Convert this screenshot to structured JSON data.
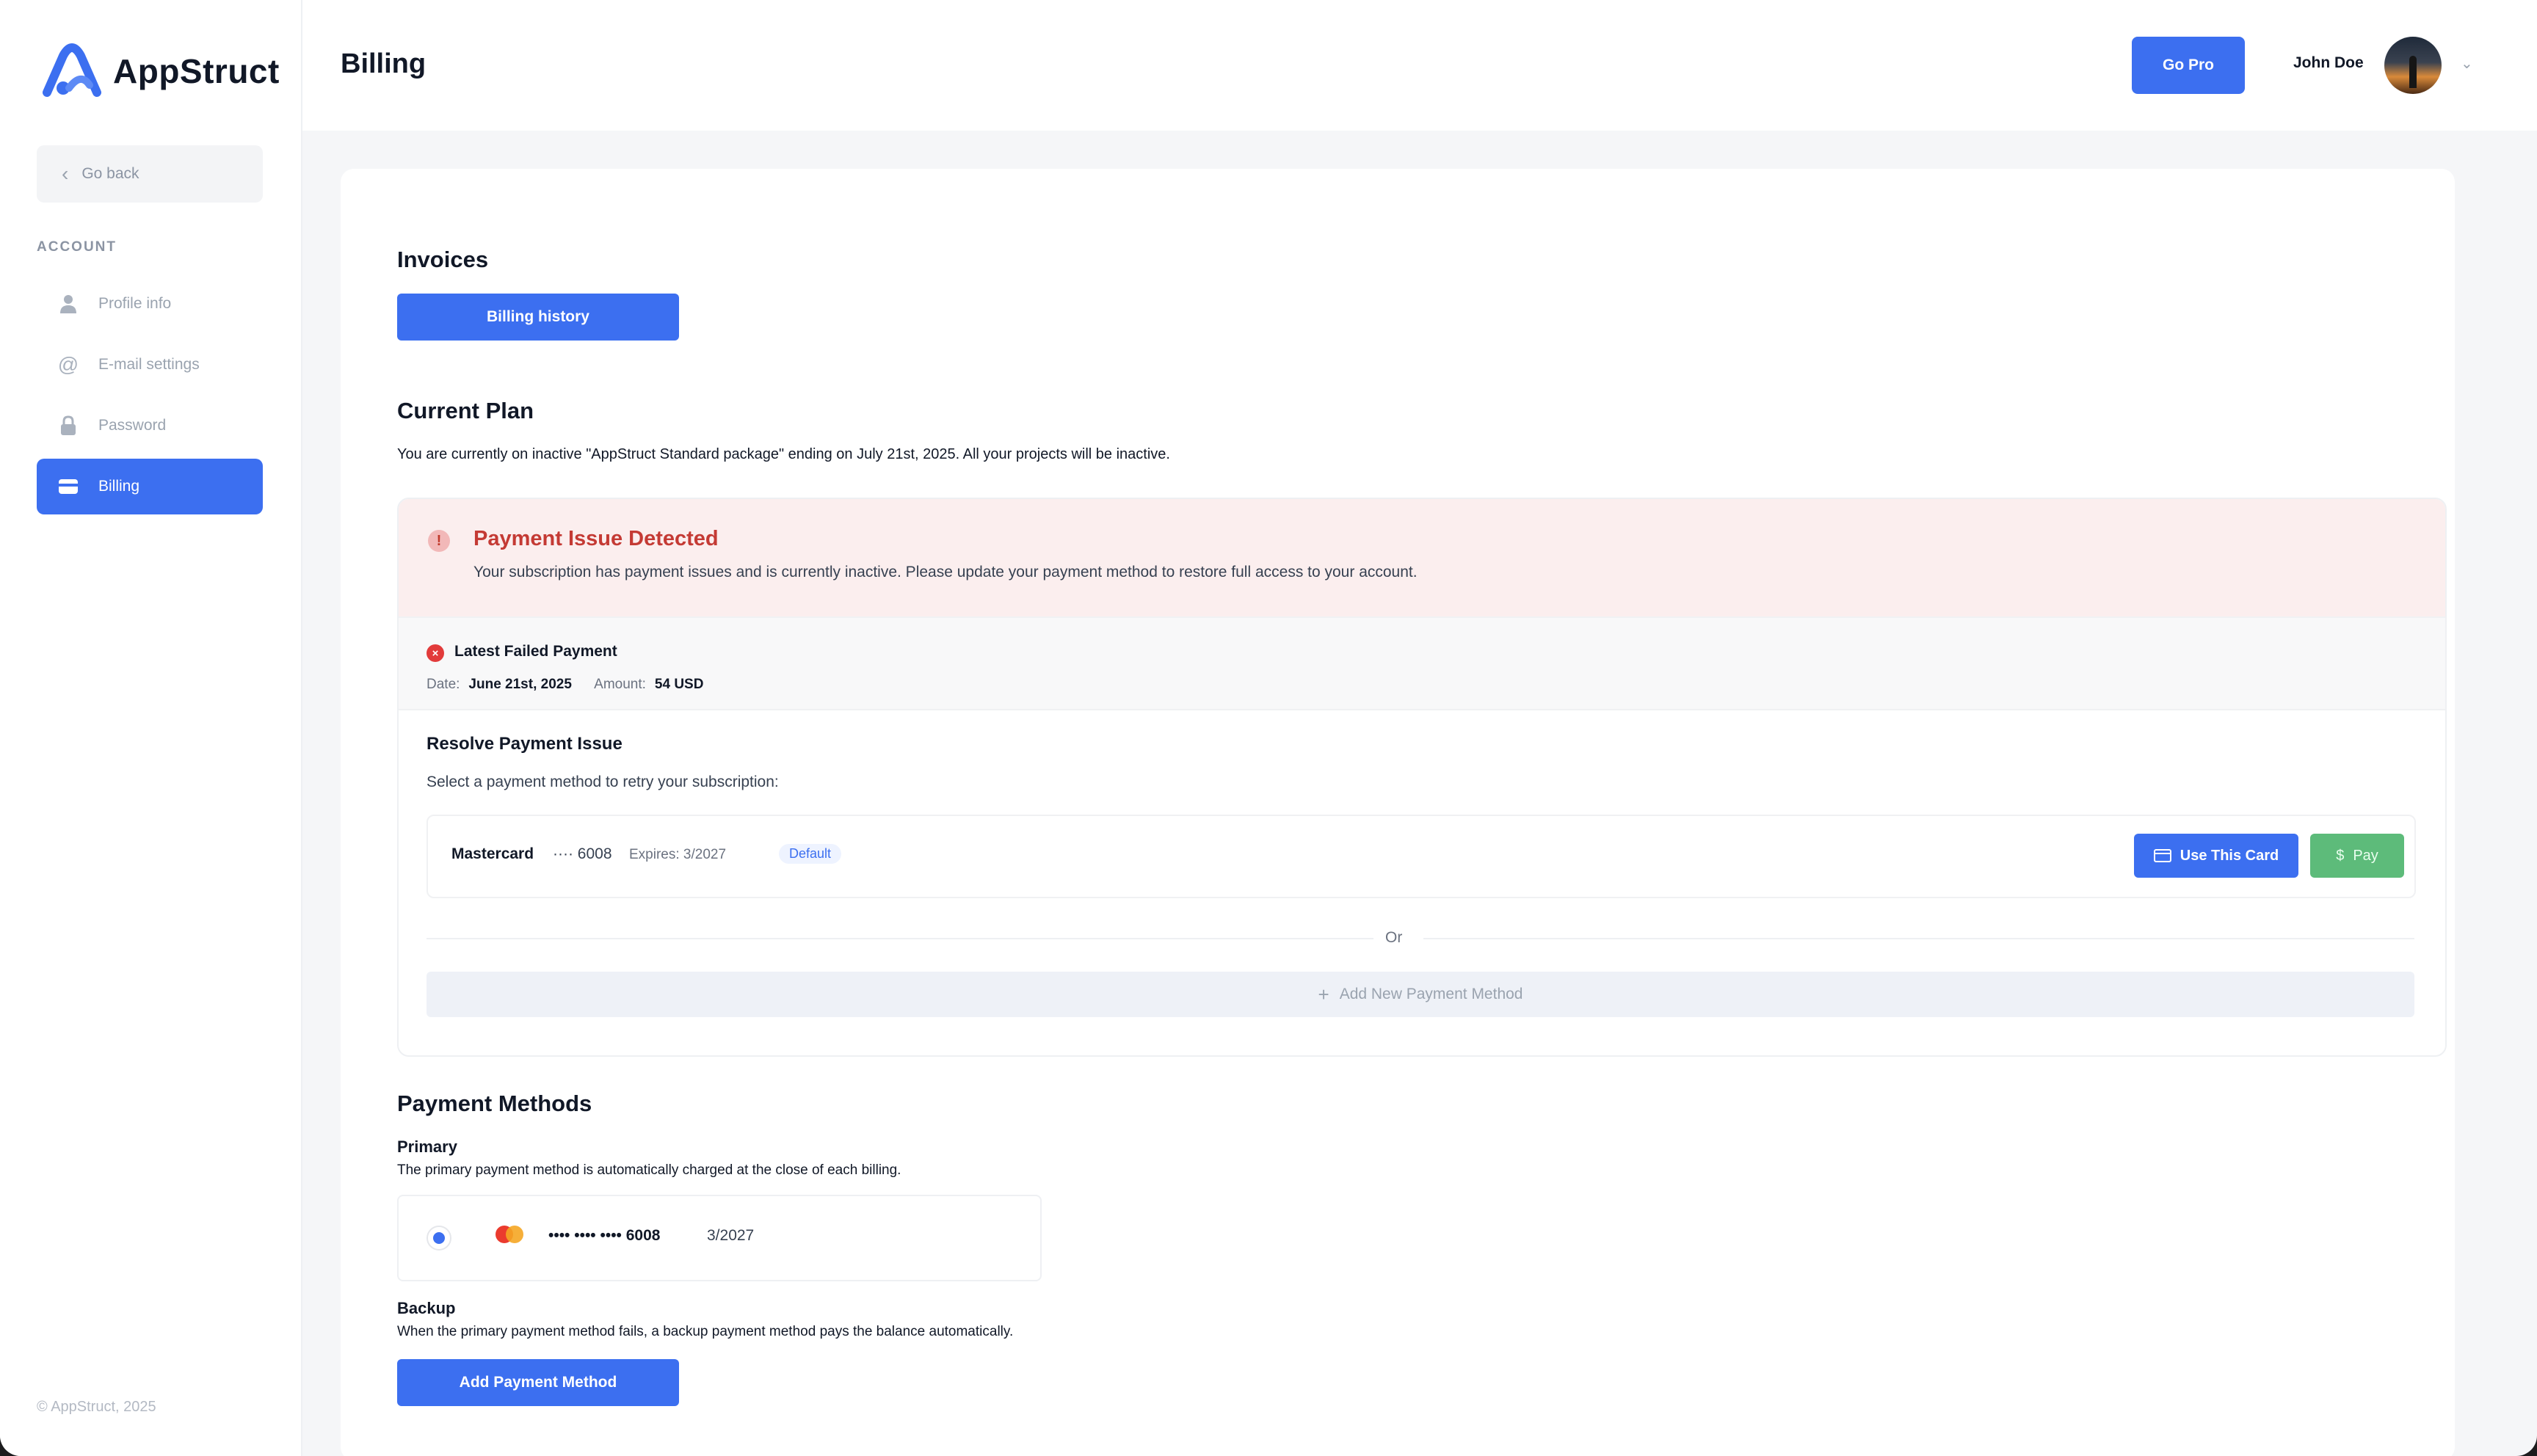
{
  "app": {
    "name": "AppStruct",
    "copyright": "© AppStruct, 2025"
  },
  "sidebar": {
    "go_back": "Go back",
    "section_label": "ACCOUNT",
    "items": [
      {
        "label": "Profile info",
        "icon": "user-icon",
        "active": false
      },
      {
        "label": "E-mail settings",
        "icon": "at-icon",
        "active": false
      },
      {
        "label": "Password",
        "icon": "lock-icon",
        "active": false
      },
      {
        "label": "Billing",
        "icon": "credit-card-icon",
        "active": true
      }
    ]
  },
  "header": {
    "title": "Billing",
    "go_pro": "Go Pro",
    "user_name": "John Doe"
  },
  "invoices": {
    "title": "Invoices",
    "billing_history": "Billing history"
  },
  "current_plan": {
    "title": "Current Plan",
    "text": "You are currently on inactive \"AppStruct Standard package\" ending on July 21st, 2025. All your projects will be inactive."
  },
  "payment_issue": {
    "title": "Payment Issue Detected",
    "description": "Your subscription has payment issues and is currently inactive. Please update your payment method to restore full access to your account.",
    "failed_title": "Latest Failed Payment",
    "date_label": "Date:",
    "date_value": "June 21st, 2025",
    "amount_label": "Amount:",
    "amount_value": "54 USD",
    "resolve_title": "Resolve Payment Issue",
    "resolve_desc": "Select a payment method to retry your subscription:",
    "card": {
      "brand": "Mastercard",
      "number": "···· 6008",
      "expires": "Expires: 3/2027",
      "badge": "Default",
      "use_label": "Use This Card",
      "pay_label": "Pay"
    },
    "or_text": "Or",
    "add_new": "Add New Payment Method"
  },
  "payment_methods": {
    "title": "Payment Methods",
    "primary_title": "Primary",
    "primary_desc": "The primary payment method is automatically charged at the close of each billing.",
    "primary_card_number": "•••• •••• •••• 6008",
    "primary_card_exp": "3/2027",
    "backup_title": "Backup",
    "backup_desc": "When the primary payment method fails, a backup payment method pays the balance automatically.",
    "add_button": "Add Payment Method"
  },
  "colors": {
    "accent": "#3c6ff0",
    "danger": "#c43a34",
    "success": "#5dbb7a"
  }
}
